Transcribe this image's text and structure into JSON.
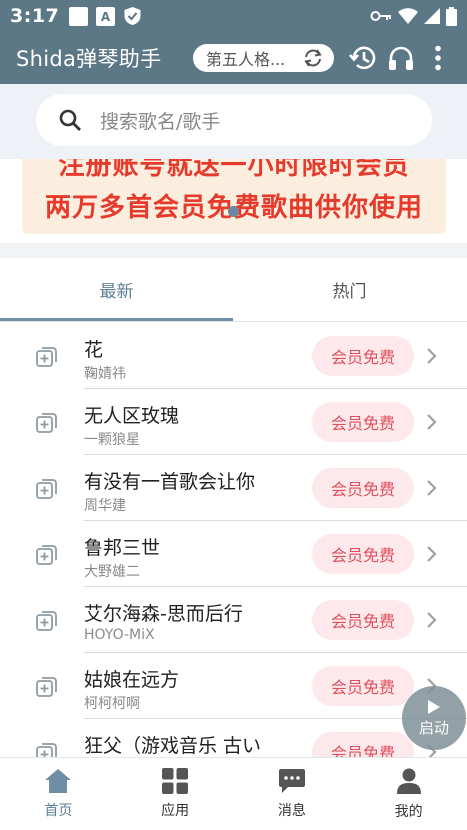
{
  "status_bar": {
    "time": "3:17",
    "left_icons": [
      "square-notification-icon",
      "a-keyboard-icon",
      "shield-icon"
    ],
    "right_icons": [
      "key-icon",
      "wifi-icon",
      "signal-icon",
      "battery-icon"
    ]
  },
  "app_bar": {
    "title": "Shida弹琴助手",
    "game_selector": "第五人格...",
    "icons": [
      "switch-icon",
      "history-icon",
      "headphones-icon",
      "more-icon"
    ]
  },
  "search": {
    "placeholder": "搜索歌名/歌手"
  },
  "banner": {
    "line1": "注册账号就送一小时限时会员",
    "line2": "两万多首会员免费歌曲供你使用"
  },
  "tabs": {
    "latest": "最新",
    "popular": "热门",
    "active": "最新"
  },
  "songs": [
    {
      "title": "花",
      "artist": "鞠婧祎",
      "badge": "会员免费"
    },
    {
      "title": "无人区玫瑰",
      "artist": "一颗狼星",
      "badge": "会员免费"
    },
    {
      "title": "有没有一首歌会让你",
      "artist": "周华建",
      "badge": "会员免费"
    },
    {
      "title": "鲁邦三世",
      "artist": "大野雄二",
      "badge": "会员免费"
    },
    {
      "title": "艾尔海森-思而后行",
      "artist": "HOYO-MiX",
      "badge": "会员免费"
    },
    {
      "title": "姑娘在远方",
      "artist": "柯柯柯啊",
      "badge": "会员免费"
    },
    {
      "title": "狂父（游戏音乐 古い",
      "artist": "",
      "badge": "会员免费"
    }
  ],
  "launch_button": {
    "label": "启动"
  },
  "bottom_nav": [
    {
      "label": "首页",
      "icon": "home-icon"
    },
    {
      "label": "应用",
      "icon": "apps-icon"
    },
    {
      "label": "消息",
      "icon": "message-icon"
    },
    {
      "label": "我的",
      "icon": "profile-icon"
    }
  ],
  "colors": {
    "primary": "#5c7786",
    "accent": "#5c7f96",
    "badge_bg": "#fde9ec",
    "badge_text": "#e0505c",
    "banner_text": "#e53a2c"
  }
}
